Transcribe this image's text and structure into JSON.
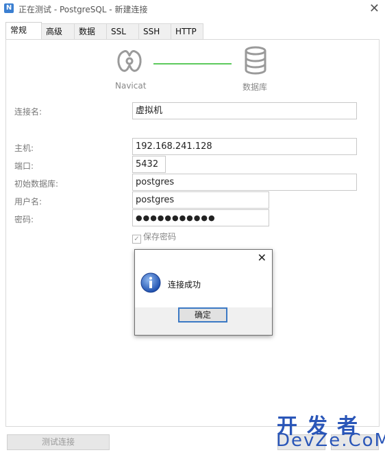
{
  "window": {
    "title": "正在测试 - PostgreSQL - 新建连接",
    "app_icon": "navicat-app-icon"
  },
  "tabs": [
    {
      "label": "常规",
      "active": true
    },
    {
      "label": "高级",
      "active": false
    },
    {
      "label": "数据库",
      "active": false
    },
    {
      "label": "SSL",
      "active": false
    },
    {
      "label": "SSH",
      "active": false
    },
    {
      "label": "HTTP",
      "active": false
    }
  ],
  "header": {
    "left_label": "Navicat",
    "right_label": "数据库",
    "connector_color": "#5cc95c"
  },
  "form": {
    "connection_name": {
      "label": "连接名:",
      "value": "虚拟机"
    },
    "host": {
      "label": "主机:",
      "value": "192.168.241.128"
    },
    "port": {
      "label": "端口:",
      "value": "5432"
    },
    "initial_db": {
      "label": "初始数据库:",
      "value": "postgres"
    },
    "username": {
      "label": "用户名:",
      "value": "postgres"
    },
    "password": {
      "label": "密码:",
      "value": "●●●●●●●●●●●"
    },
    "save_password": {
      "label": "保存密码",
      "checked": true
    }
  },
  "dialog": {
    "message": "连接成功",
    "ok_label": "确定",
    "close_glyph": "✕"
  },
  "footer": {
    "test_button_label": "测试连接"
  },
  "watermark": {
    "top": "开发者",
    "bottom": "DevZe.CoM"
  }
}
